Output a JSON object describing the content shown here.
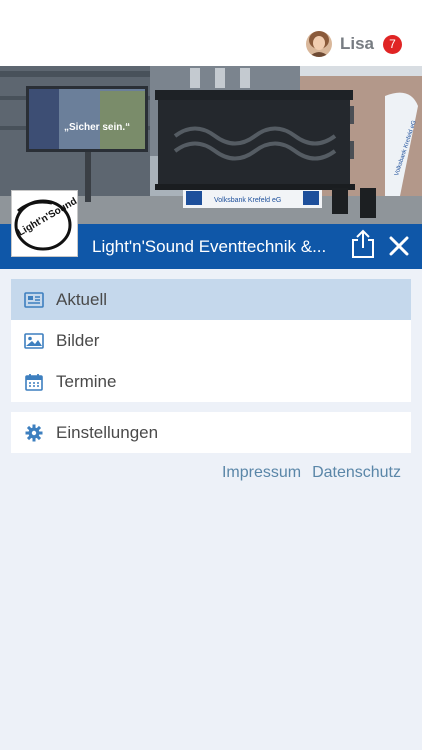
{
  "user": {
    "name": "Lisa",
    "notifications": "7"
  },
  "hero": {
    "billboard_text": "„Sicher sein.“",
    "banner_text": "Volksbank Krefeld eG",
    "flag_text": "Volksbank Krefeld eG"
  },
  "logo": {
    "text": "Light'n'Sound"
  },
  "header": {
    "title": "Light'n'Sound Eventtechnik &..."
  },
  "menu": {
    "main": [
      {
        "label": "Aktuell",
        "icon": "newspaper-icon",
        "active": true
      },
      {
        "label": "Bilder",
        "icon": "image-icon",
        "active": false
      },
      {
        "label": "Termine",
        "icon": "calendar-icon",
        "active": false
      }
    ],
    "settings": {
      "label": "Einstellungen",
      "icon": "gear-icon"
    }
  },
  "footer_links": {
    "impressum": "Impressum",
    "datenschutz": "Datenschutz"
  },
  "colors": {
    "accent": "#0f57a8",
    "active_bg": "#c5d8ec",
    "badge": "#e02424",
    "page_bg": "#edf1f8"
  }
}
